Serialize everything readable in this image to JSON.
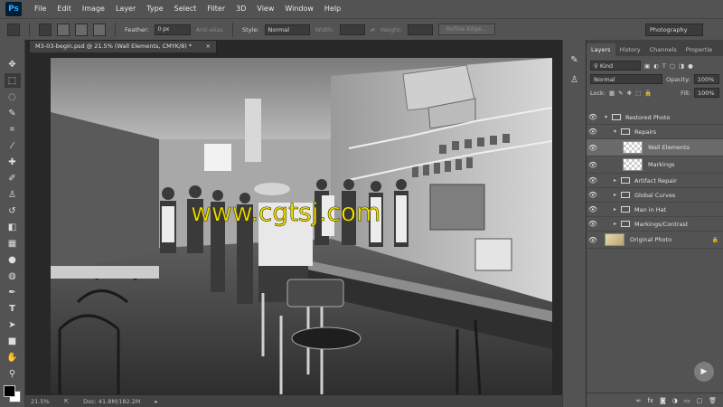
{
  "app": {
    "logo": "Ps",
    "menu": [
      "File",
      "Edit",
      "Image",
      "Layer",
      "Type",
      "Select",
      "Filter",
      "3D",
      "View",
      "Window",
      "Help"
    ]
  },
  "options": {
    "feather_label": "Feather:",
    "feather_value": "0 px",
    "antialias_label": "Anti-alias",
    "style_label": "Style:",
    "style_value": "Normal",
    "width_label": "Width:",
    "height_label": "Height:",
    "refine_label": "Refine Edge...",
    "workspace": "Photography"
  },
  "document": {
    "tab_title": "M3-03-begin.psd @ 21.5% (Wall Elements, CMYK/8) *",
    "tab_close": "×",
    "watermark": "www.cgtsj.com"
  },
  "status": {
    "zoom": "21.5%",
    "doc_size": "Doc: 41.8M/182.2M"
  },
  "panels": {
    "tabs": [
      "Layers",
      "History",
      "Channels",
      "Propertie"
    ],
    "kind": "Kind",
    "blend_mode": "Normal",
    "opacity_label": "Opacity:",
    "opacity_value": "100%",
    "lock_label": "Lock:",
    "fill_label": "Fill:",
    "fill_value": "100%"
  },
  "layers": [
    {
      "name": "Restored Photo",
      "type": "group",
      "indent": 0,
      "expanded": true
    },
    {
      "name": "Repairs",
      "type": "group",
      "indent": 1,
      "expanded": true
    },
    {
      "name": "Wall Elements",
      "type": "layer",
      "indent": 2,
      "selected": true
    },
    {
      "name": "Markings",
      "type": "layer",
      "indent": 2
    },
    {
      "name": "Artifact Repair",
      "type": "group",
      "indent": 1
    },
    {
      "name": "Global Curves",
      "type": "group",
      "indent": 1
    },
    {
      "name": "Man in Hat",
      "type": "group",
      "indent": 1
    },
    {
      "name": "Markings/Contrast",
      "type": "group",
      "indent": 1
    },
    {
      "name": "Original Photo",
      "type": "photo",
      "indent": 0
    }
  ],
  "colors": {
    "chrome": "#535353",
    "dark": "#282828",
    "watermark": "#f2e300",
    "ps_blue": "#31a8ff"
  }
}
